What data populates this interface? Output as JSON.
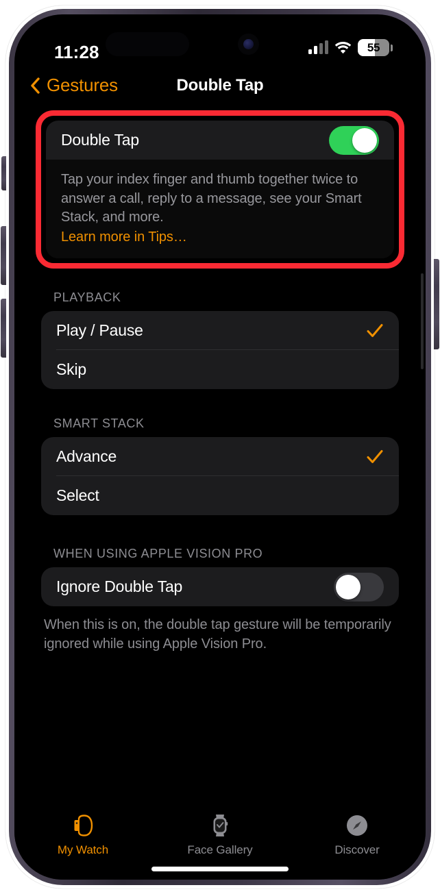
{
  "status_bar": {
    "time": "11:28",
    "battery_percent": "55",
    "battery_level": 55,
    "signal_icon": "cellular-signal-icon",
    "wifi_icon": "wifi-icon",
    "battery_icon": "battery-icon"
  },
  "nav": {
    "back_label": "Gestures",
    "back_icon": "chevron-left-icon",
    "title": "Double Tap"
  },
  "highlight": {
    "color": "#fa2a33"
  },
  "double_tap": {
    "label": "Double Tap",
    "toggle_state": "on",
    "description": "Tap your index finger and thumb together twice to answer a call, reply to a message, see your Smart Stack, and more.",
    "link": "Learn more in Tips…"
  },
  "playback": {
    "header": "PLAYBACK",
    "items": [
      {
        "label": "Play / Pause",
        "checked": true
      },
      {
        "label": "Skip",
        "checked": false
      }
    ]
  },
  "smart_stack": {
    "header": "SMART STACK",
    "items": [
      {
        "label": "Advance",
        "checked": true
      },
      {
        "label": "Select",
        "checked": false
      }
    ]
  },
  "vision_pro": {
    "header": "WHEN USING APPLE VISION PRO",
    "label": "Ignore Double Tap",
    "toggle_state": "off",
    "description": "When this is on, the double tap gesture will be temporarily ignored while using Apple Vision Pro."
  },
  "tab_bar": {
    "tabs": [
      {
        "label": "My Watch",
        "icon": "watch-side-icon",
        "active": true
      },
      {
        "label": "Face Gallery",
        "icon": "watch-face-icon",
        "active": false
      },
      {
        "label": "Discover",
        "icon": "compass-icon",
        "active": false
      }
    ]
  },
  "colors": {
    "accent_orange": "#f09000",
    "toggle_on_green": "#2fd158",
    "highlight_red": "#fa2a33",
    "group_bg": "#1c1c1e",
    "secondary_text": "#8d8d92"
  }
}
